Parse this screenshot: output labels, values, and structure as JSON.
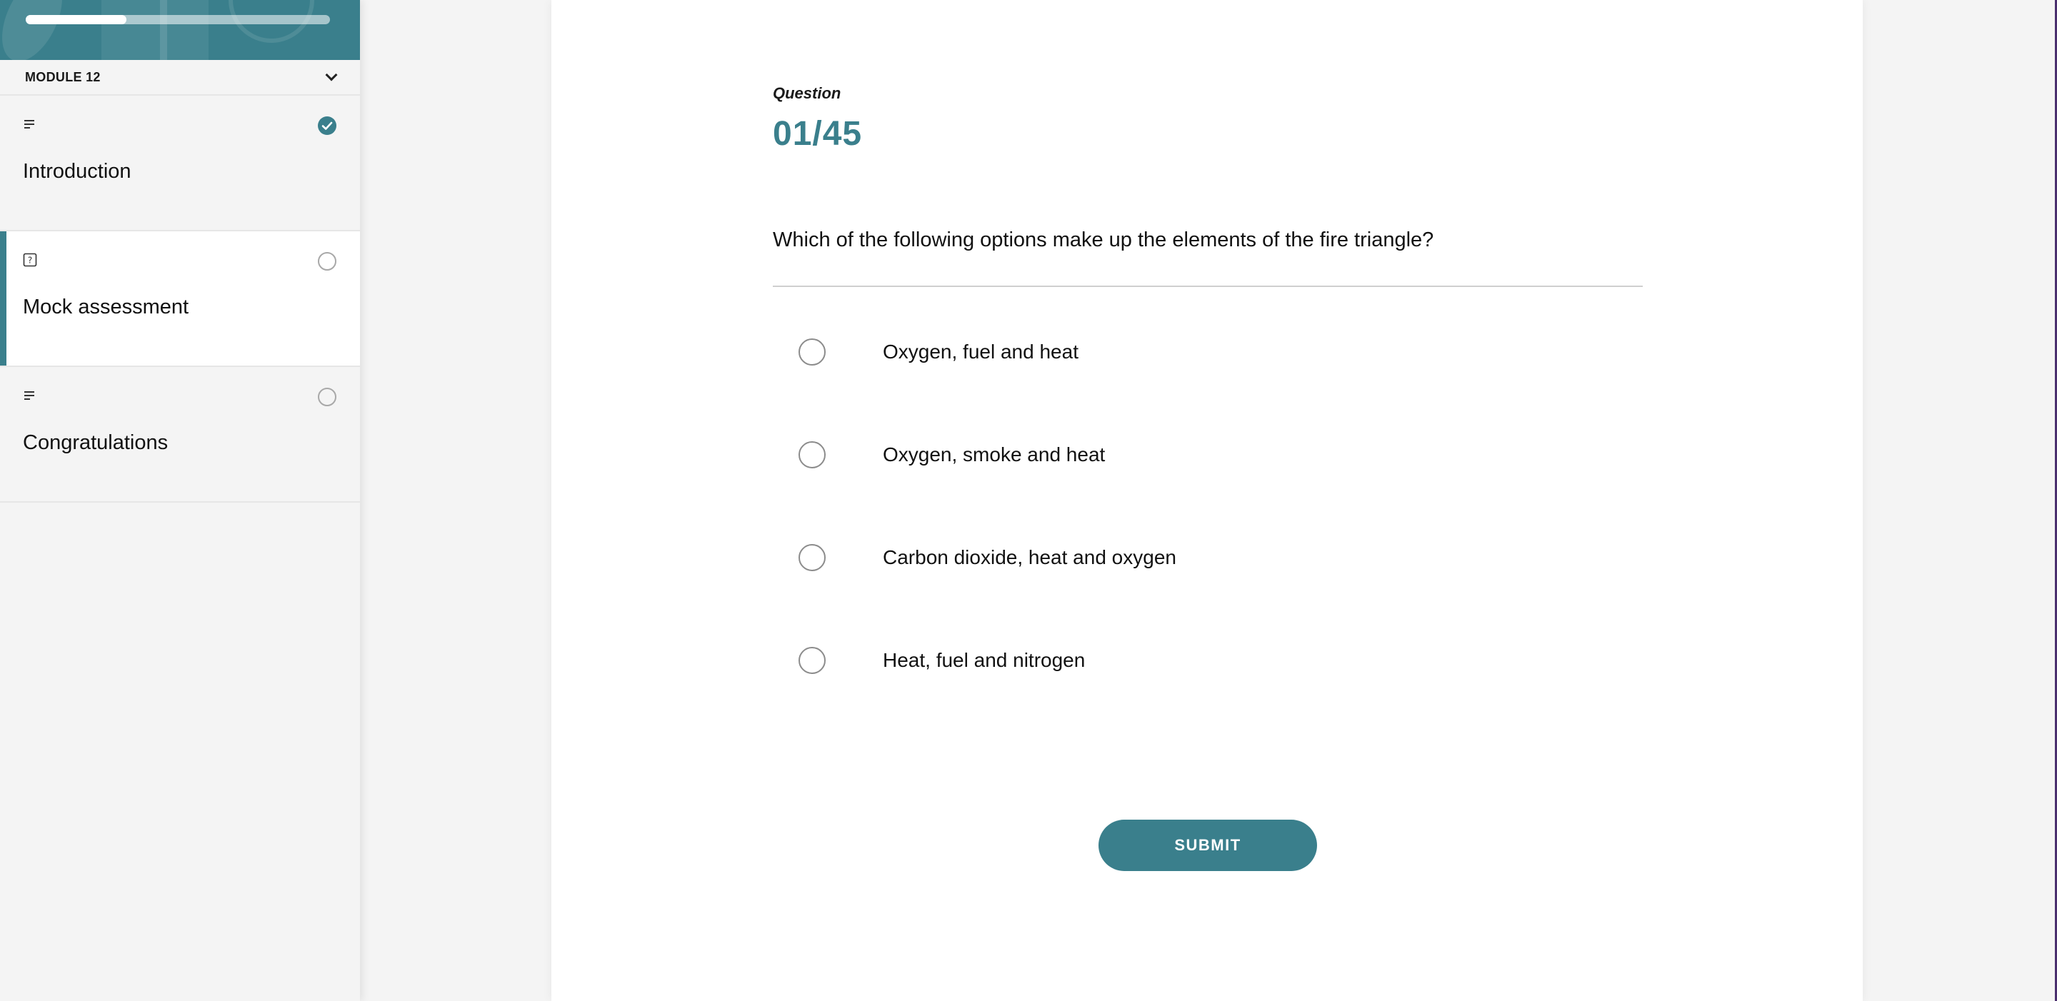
{
  "sidebar": {
    "progress_percent": 33,
    "module": {
      "label": "MODULE 12",
      "icon": "chevron-down-icon"
    },
    "lessons": [
      {
        "title": "Introduction",
        "type_icon": "text-lines-icon",
        "status": "completed",
        "status_icon": "check-circle-icon"
      },
      {
        "title": "Mock assessment",
        "type_icon": "question-box-icon",
        "status": "not-started",
        "status_icon": "empty-circle-icon",
        "active": true
      },
      {
        "title": "Congratulations",
        "type_icon": "text-lines-icon",
        "status": "not-started",
        "status_icon": "empty-circle-icon"
      }
    ]
  },
  "quiz": {
    "kicker": "Question",
    "number": "01/45",
    "question": "Which of the following options make up the elements of the fire triangle?",
    "options": [
      {
        "label": "Oxygen, fuel and heat"
      },
      {
        "label": "Oxygen, smoke and heat"
      },
      {
        "label": "Carbon dioxide, heat and oxygen"
      },
      {
        "label": "Heat, fuel and nitrogen"
      }
    ],
    "submit_label": "SUBMIT"
  },
  "colors": {
    "accent": "#3a7f8c",
    "sidebar_bg": "#f4f4f4",
    "card_bg": "#ffffff"
  }
}
